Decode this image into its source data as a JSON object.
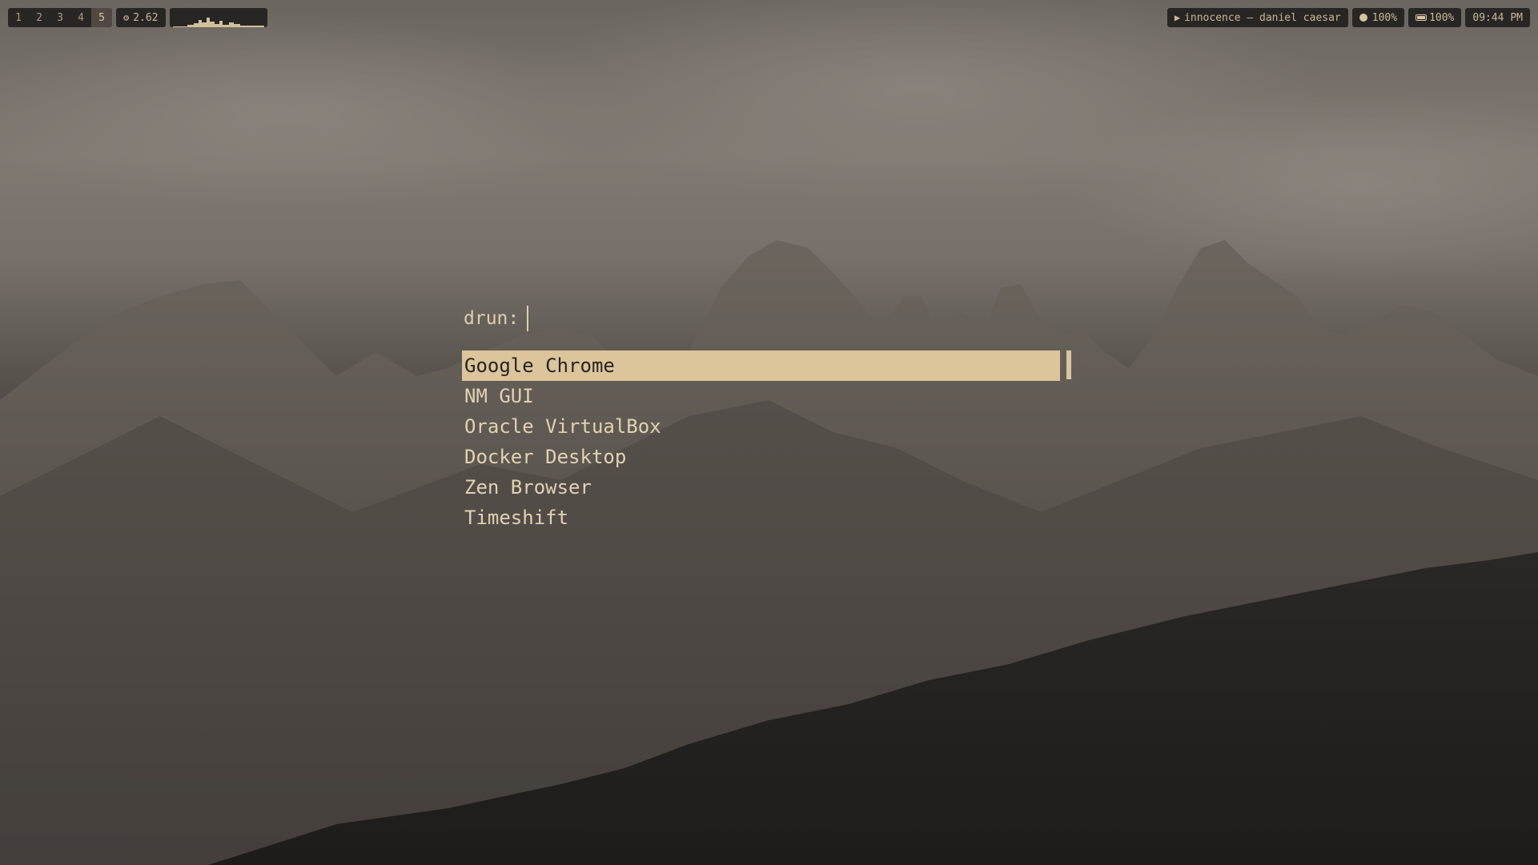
{
  "topbar": {
    "workspaces": [
      "1",
      "2",
      "3",
      "4",
      "5"
    ],
    "active_workspace": "5",
    "cpu": {
      "icon": "gear-icon",
      "value": "2.62"
    },
    "graph_icon": "cpu-usage-graph",
    "media": {
      "icon": "play-icon",
      "text": "innocence — daniel caesar"
    },
    "volume": {
      "icon": "dot-icon",
      "value": "100%"
    },
    "battery": {
      "icon": "battery-icon",
      "value": "100%"
    },
    "clock": "09:44 PM"
  },
  "launcher": {
    "prompt_label": "drun:",
    "query": "",
    "items": [
      {
        "label": "Google Chrome"
      },
      {
        "label": "NM GUI"
      },
      {
        "label": "Oracle VirtualBox"
      },
      {
        "label": "Docker Desktop"
      },
      {
        "label": "Zen Browser"
      },
      {
        "label": "Timeshift"
      }
    ],
    "selected_index": 0
  },
  "colors": {
    "accent": "#dcc59b",
    "bar_bg": "#282624",
    "text": "#dfcfae"
  }
}
